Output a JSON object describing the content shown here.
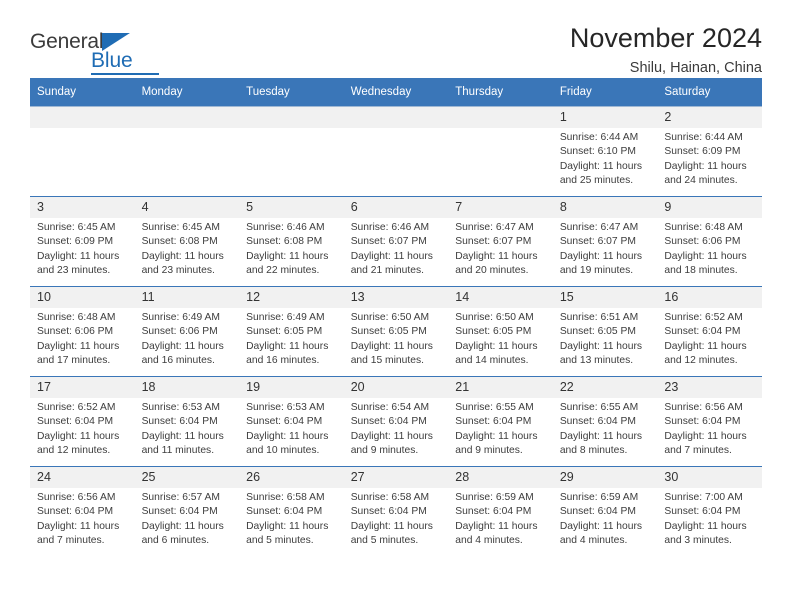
{
  "logo": {
    "word_top": "General",
    "word_bottom": "Blue",
    "accent_color": "#1f6cb4"
  },
  "header": {
    "title": "November 2024",
    "subtitle": "Shilu, Hainan, China"
  },
  "theme": {
    "header_blue": "#3a76b8",
    "daynum_band": "#f1f1f1",
    "text": "#333333"
  },
  "calendar": {
    "weekday_headers": [
      "Sunday",
      "Monday",
      "Tuesday",
      "Wednesday",
      "Thursday",
      "Friday",
      "Saturday"
    ],
    "weeks": [
      [
        {
          "day": "",
          "lines": []
        },
        {
          "day": "",
          "lines": []
        },
        {
          "day": "",
          "lines": []
        },
        {
          "day": "",
          "lines": []
        },
        {
          "day": "",
          "lines": []
        },
        {
          "day": "1",
          "lines": [
            "Sunrise: 6:44 AM",
            "Sunset: 6:10 PM",
            "Daylight: 11 hours",
            "and 25 minutes."
          ]
        },
        {
          "day": "2",
          "lines": [
            "Sunrise: 6:44 AM",
            "Sunset: 6:09 PM",
            "Daylight: 11 hours",
            "and 24 minutes."
          ]
        }
      ],
      [
        {
          "day": "3",
          "lines": [
            "Sunrise: 6:45 AM",
            "Sunset: 6:09 PM",
            "Daylight: 11 hours",
            "and 23 minutes."
          ]
        },
        {
          "day": "4",
          "lines": [
            "Sunrise: 6:45 AM",
            "Sunset: 6:08 PM",
            "Daylight: 11 hours",
            "and 23 minutes."
          ]
        },
        {
          "day": "5",
          "lines": [
            "Sunrise: 6:46 AM",
            "Sunset: 6:08 PM",
            "Daylight: 11 hours",
            "and 22 minutes."
          ]
        },
        {
          "day": "6",
          "lines": [
            "Sunrise: 6:46 AM",
            "Sunset: 6:07 PM",
            "Daylight: 11 hours",
            "and 21 minutes."
          ]
        },
        {
          "day": "7",
          "lines": [
            "Sunrise: 6:47 AM",
            "Sunset: 6:07 PM",
            "Daylight: 11 hours",
            "and 20 minutes."
          ]
        },
        {
          "day": "8",
          "lines": [
            "Sunrise: 6:47 AM",
            "Sunset: 6:07 PM",
            "Daylight: 11 hours",
            "and 19 minutes."
          ]
        },
        {
          "day": "9",
          "lines": [
            "Sunrise: 6:48 AM",
            "Sunset: 6:06 PM",
            "Daylight: 11 hours",
            "and 18 minutes."
          ]
        }
      ],
      [
        {
          "day": "10",
          "lines": [
            "Sunrise: 6:48 AM",
            "Sunset: 6:06 PM",
            "Daylight: 11 hours",
            "and 17 minutes."
          ]
        },
        {
          "day": "11",
          "lines": [
            "Sunrise: 6:49 AM",
            "Sunset: 6:06 PM",
            "Daylight: 11 hours",
            "and 16 minutes."
          ]
        },
        {
          "day": "12",
          "lines": [
            "Sunrise: 6:49 AM",
            "Sunset: 6:05 PM",
            "Daylight: 11 hours",
            "and 16 minutes."
          ]
        },
        {
          "day": "13",
          "lines": [
            "Sunrise: 6:50 AM",
            "Sunset: 6:05 PM",
            "Daylight: 11 hours",
            "and 15 minutes."
          ]
        },
        {
          "day": "14",
          "lines": [
            "Sunrise: 6:50 AM",
            "Sunset: 6:05 PM",
            "Daylight: 11 hours",
            "and 14 minutes."
          ]
        },
        {
          "day": "15",
          "lines": [
            "Sunrise: 6:51 AM",
            "Sunset: 6:05 PM",
            "Daylight: 11 hours",
            "and 13 minutes."
          ]
        },
        {
          "day": "16",
          "lines": [
            "Sunrise: 6:52 AM",
            "Sunset: 6:04 PM",
            "Daylight: 11 hours",
            "and 12 minutes."
          ]
        }
      ],
      [
        {
          "day": "17",
          "lines": [
            "Sunrise: 6:52 AM",
            "Sunset: 6:04 PM",
            "Daylight: 11 hours",
            "and 12 minutes."
          ]
        },
        {
          "day": "18",
          "lines": [
            "Sunrise: 6:53 AM",
            "Sunset: 6:04 PM",
            "Daylight: 11 hours",
            "and 11 minutes."
          ]
        },
        {
          "day": "19",
          "lines": [
            "Sunrise: 6:53 AM",
            "Sunset: 6:04 PM",
            "Daylight: 11 hours",
            "and 10 minutes."
          ]
        },
        {
          "day": "20",
          "lines": [
            "Sunrise: 6:54 AM",
            "Sunset: 6:04 PM",
            "Daylight: 11 hours",
            "and 9 minutes."
          ]
        },
        {
          "day": "21",
          "lines": [
            "Sunrise: 6:55 AM",
            "Sunset: 6:04 PM",
            "Daylight: 11 hours",
            "and 9 minutes."
          ]
        },
        {
          "day": "22",
          "lines": [
            "Sunrise: 6:55 AM",
            "Sunset: 6:04 PM",
            "Daylight: 11 hours",
            "and 8 minutes."
          ]
        },
        {
          "day": "23",
          "lines": [
            "Sunrise: 6:56 AM",
            "Sunset: 6:04 PM",
            "Daylight: 11 hours",
            "and 7 minutes."
          ]
        }
      ],
      [
        {
          "day": "24",
          "lines": [
            "Sunrise: 6:56 AM",
            "Sunset: 6:04 PM",
            "Daylight: 11 hours",
            "and 7 minutes."
          ]
        },
        {
          "day": "25",
          "lines": [
            "Sunrise: 6:57 AM",
            "Sunset: 6:04 PM",
            "Daylight: 11 hours",
            "and 6 minutes."
          ]
        },
        {
          "day": "26",
          "lines": [
            "Sunrise: 6:58 AM",
            "Sunset: 6:04 PM",
            "Daylight: 11 hours",
            "and 5 minutes."
          ]
        },
        {
          "day": "27",
          "lines": [
            "Sunrise: 6:58 AM",
            "Sunset: 6:04 PM",
            "Daylight: 11 hours",
            "and 5 minutes."
          ]
        },
        {
          "day": "28",
          "lines": [
            "Sunrise: 6:59 AM",
            "Sunset: 6:04 PM",
            "Daylight: 11 hours",
            "and 4 minutes."
          ]
        },
        {
          "day": "29",
          "lines": [
            "Sunrise: 6:59 AM",
            "Sunset: 6:04 PM",
            "Daylight: 11 hours",
            "and 4 minutes."
          ]
        },
        {
          "day": "30",
          "lines": [
            "Sunrise: 7:00 AM",
            "Sunset: 6:04 PM",
            "Daylight: 11 hours",
            "and 3 minutes."
          ]
        }
      ]
    ]
  }
}
